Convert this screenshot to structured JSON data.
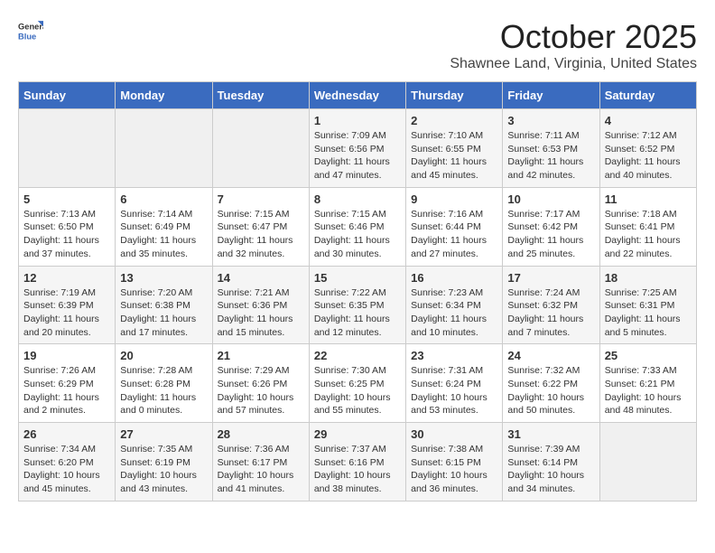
{
  "header": {
    "logo_general": "General",
    "logo_blue": "Blue",
    "month_title": "October 2025",
    "location": "Shawnee Land, Virginia, United States"
  },
  "days_of_week": [
    "Sunday",
    "Monday",
    "Tuesday",
    "Wednesday",
    "Thursday",
    "Friday",
    "Saturday"
  ],
  "weeks": [
    [
      {
        "day": "",
        "info": ""
      },
      {
        "day": "",
        "info": ""
      },
      {
        "day": "",
        "info": ""
      },
      {
        "day": "1",
        "info": "Sunrise: 7:09 AM\nSunset: 6:56 PM\nDaylight: 11 hours\nand 47 minutes."
      },
      {
        "day": "2",
        "info": "Sunrise: 7:10 AM\nSunset: 6:55 PM\nDaylight: 11 hours\nand 45 minutes."
      },
      {
        "day": "3",
        "info": "Sunrise: 7:11 AM\nSunset: 6:53 PM\nDaylight: 11 hours\nand 42 minutes."
      },
      {
        "day": "4",
        "info": "Sunrise: 7:12 AM\nSunset: 6:52 PM\nDaylight: 11 hours\nand 40 minutes."
      }
    ],
    [
      {
        "day": "5",
        "info": "Sunrise: 7:13 AM\nSunset: 6:50 PM\nDaylight: 11 hours\nand 37 minutes."
      },
      {
        "day": "6",
        "info": "Sunrise: 7:14 AM\nSunset: 6:49 PM\nDaylight: 11 hours\nand 35 minutes."
      },
      {
        "day": "7",
        "info": "Sunrise: 7:15 AM\nSunset: 6:47 PM\nDaylight: 11 hours\nand 32 minutes."
      },
      {
        "day": "8",
        "info": "Sunrise: 7:15 AM\nSunset: 6:46 PM\nDaylight: 11 hours\nand 30 minutes."
      },
      {
        "day": "9",
        "info": "Sunrise: 7:16 AM\nSunset: 6:44 PM\nDaylight: 11 hours\nand 27 minutes."
      },
      {
        "day": "10",
        "info": "Sunrise: 7:17 AM\nSunset: 6:42 PM\nDaylight: 11 hours\nand 25 minutes."
      },
      {
        "day": "11",
        "info": "Sunrise: 7:18 AM\nSunset: 6:41 PM\nDaylight: 11 hours\nand 22 minutes."
      }
    ],
    [
      {
        "day": "12",
        "info": "Sunrise: 7:19 AM\nSunset: 6:39 PM\nDaylight: 11 hours\nand 20 minutes."
      },
      {
        "day": "13",
        "info": "Sunrise: 7:20 AM\nSunset: 6:38 PM\nDaylight: 11 hours\nand 17 minutes."
      },
      {
        "day": "14",
        "info": "Sunrise: 7:21 AM\nSunset: 6:36 PM\nDaylight: 11 hours\nand 15 minutes."
      },
      {
        "day": "15",
        "info": "Sunrise: 7:22 AM\nSunset: 6:35 PM\nDaylight: 11 hours\nand 12 minutes."
      },
      {
        "day": "16",
        "info": "Sunrise: 7:23 AM\nSunset: 6:34 PM\nDaylight: 11 hours\nand 10 minutes."
      },
      {
        "day": "17",
        "info": "Sunrise: 7:24 AM\nSunset: 6:32 PM\nDaylight: 11 hours\nand 7 minutes."
      },
      {
        "day": "18",
        "info": "Sunrise: 7:25 AM\nSunset: 6:31 PM\nDaylight: 11 hours\nand 5 minutes."
      }
    ],
    [
      {
        "day": "19",
        "info": "Sunrise: 7:26 AM\nSunset: 6:29 PM\nDaylight: 11 hours\nand 2 minutes."
      },
      {
        "day": "20",
        "info": "Sunrise: 7:28 AM\nSunset: 6:28 PM\nDaylight: 11 hours\nand 0 minutes."
      },
      {
        "day": "21",
        "info": "Sunrise: 7:29 AM\nSunset: 6:26 PM\nDaylight: 10 hours\nand 57 minutes."
      },
      {
        "day": "22",
        "info": "Sunrise: 7:30 AM\nSunset: 6:25 PM\nDaylight: 10 hours\nand 55 minutes."
      },
      {
        "day": "23",
        "info": "Sunrise: 7:31 AM\nSunset: 6:24 PM\nDaylight: 10 hours\nand 53 minutes."
      },
      {
        "day": "24",
        "info": "Sunrise: 7:32 AM\nSunset: 6:22 PM\nDaylight: 10 hours\nand 50 minutes."
      },
      {
        "day": "25",
        "info": "Sunrise: 7:33 AM\nSunset: 6:21 PM\nDaylight: 10 hours\nand 48 minutes."
      }
    ],
    [
      {
        "day": "26",
        "info": "Sunrise: 7:34 AM\nSunset: 6:20 PM\nDaylight: 10 hours\nand 45 minutes."
      },
      {
        "day": "27",
        "info": "Sunrise: 7:35 AM\nSunset: 6:19 PM\nDaylight: 10 hours\nand 43 minutes."
      },
      {
        "day": "28",
        "info": "Sunrise: 7:36 AM\nSunset: 6:17 PM\nDaylight: 10 hours\nand 41 minutes."
      },
      {
        "day": "29",
        "info": "Sunrise: 7:37 AM\nSunset: 6:16 PM\nDaylight: 10 hours\nand 38 minutes."
      },
      {
        "day": "30",
        "info": "Sunrise: 7:38 AM\nSunset: 6:15 PM\nDaylight: 10 hours\nand 36 minutes."
      },
      {
        "day": "31",
        "info": "Sunrise: 7:39 AM\nSunset: 6:14 PM\nDaylight: 10 hours\nand 34 minutes."
      },
      {
        "day": "",
        "info": ""
      }
    ]
  ]
}
